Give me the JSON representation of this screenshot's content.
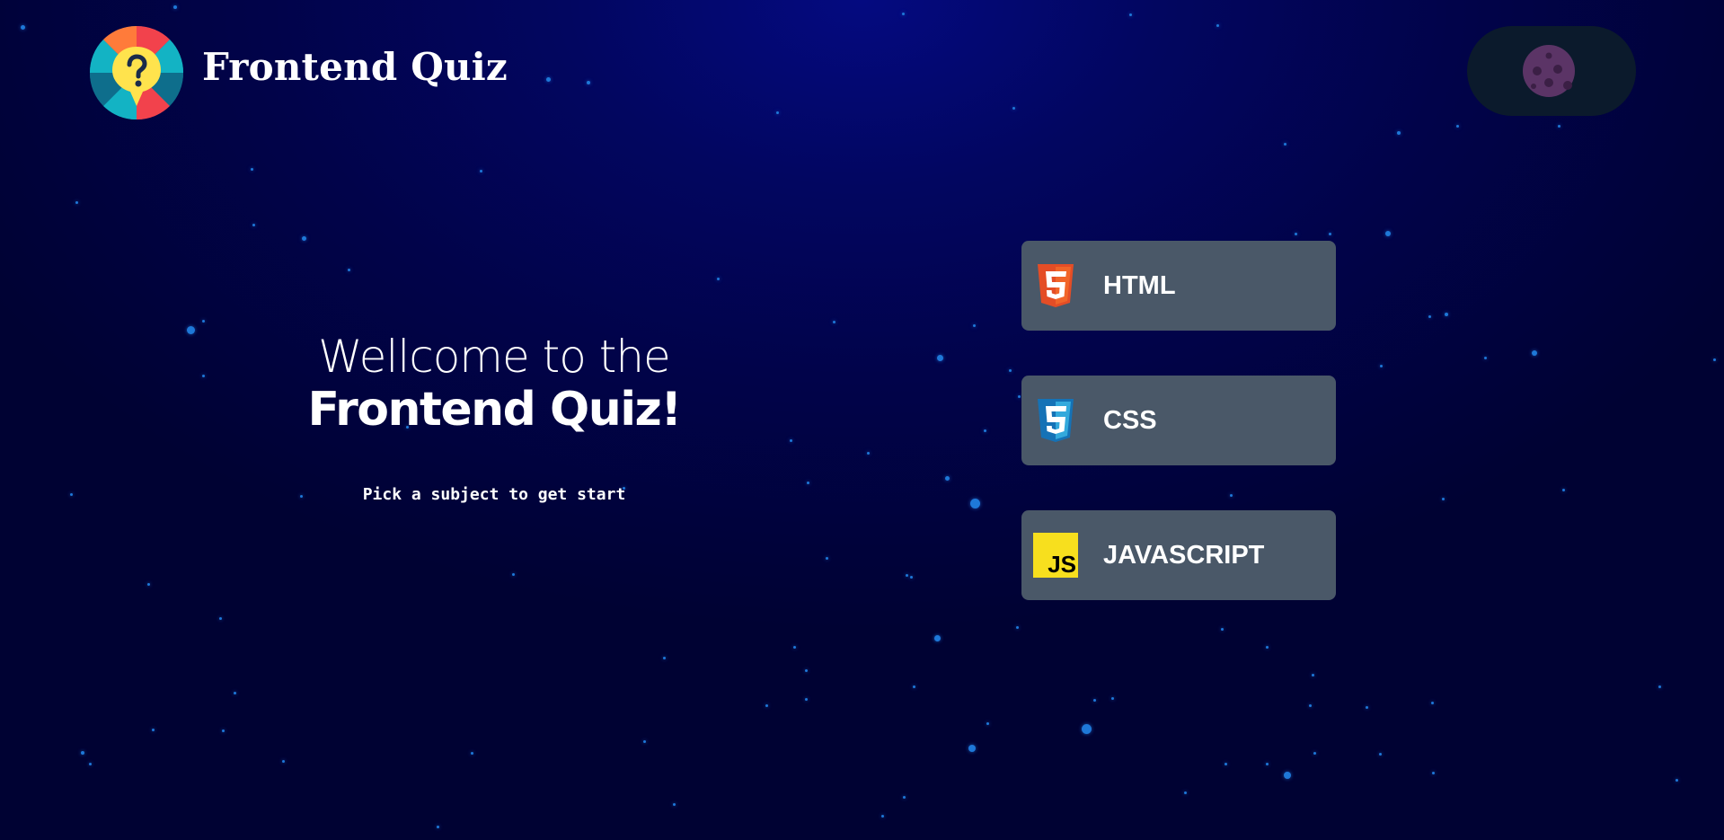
{
  "header": {
    "title": "Frontend Quiz",
    "logo_icon": "quiz-question-icon",
    "theme_toggle_icon": "moon-icon"
  },
  "welcome": {
    "line1": "Wellcome to the",
    "line2": "Frontend Quiz!",
    "subtitle": "Pick a subject to get start"
  },
  "subjects": [
    {
      "label": "HTML",
      "icon": "html5-icon",
      "color": "#e44d26"
    },
    {
      "label": "CSS",
      "icon": "css3-icon",
      "color": "#2965f1"
    },
    {
      "label": "JAVASCRIPT",
      "icon": "js-icon",
      "color": "#f7df1e"
    }
  ],
  "colors": {
    "background": "#020660",
    "star": "#1e78d8",
    "subject_card": "#4a5868",
    "toggle": "#0b1a2c",
    "moon": "#5b3466"
  }
}
